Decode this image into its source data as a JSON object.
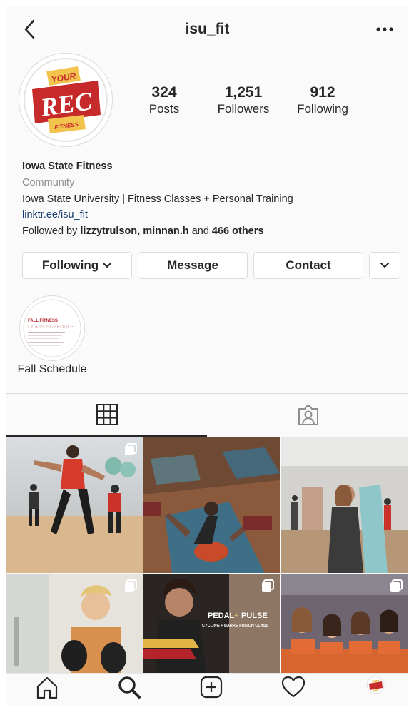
{
  "header": {
    "username": "isu_fit",
    "back_icon": "chevron-left-icon",
    "more_icon": "more-horizontal-icon"
  },
  "avatar": {
    "logo_top": "YOUR",
    "logo_main": "REC",
    "logo_bottom": "FITNESS",
    "colors": {
      "red": "#c62a2a",
      "gold": "#f2c44e"
    }
  },
  "stats": [
    {
      "value": "324",
      "label": "Posts"
    },
    {
      "value": "1,251",
      "label": "Followers"
    },
    {
      "value": "912",
      "label": "Following"
    }
  ],
  "bio": {
    "name": "Iowa State Fitness",
    "category": "Community",
    "description": "Iowa State University | Fitness Classes + Personal Training",
    "link": "linktr.ee/isu_fit",
    "followed_prefix": "Followed by ",
    "followed_users": "lizzytrulson, minnan.h",
    "followed_and": " and ",
    "followed_others": "466 others"
  },
  "buttons": {
    "following": "Following",
    "message": "Message",
    "contact": "Contact"
  },
  "highlight": {
    "label": "Fall Schedule",
    "cover_title_1": "FALL FITNESS",
    "cover_title_2": "CLASS SCHEDULE"
  },
  "tabs": [
    {
      "icon": "grid-icon",
      "active": true
    },
    {
      "icon": "tagged-icon",
      "active": false
    }
  ],
  "posts": [
    {
      "kind": "zumba class photo",
      "multi": true
    },
    {
      "kind": "yoga mats photo",
      "multi": false
    },
    {
      "kind": "woman with towel photo",
      "multi": false
    },
    {
      "kind": "boxing woman photo",
      "multi": true
    },
    {
      "kind": "pedal + pulse promo",
      "multi": true,
      "title_left": "PEDAL",
      "title_right": "PULSE",
      "subtitle": "CYCLING + BARRE FUSION CLASS"
    },
    {
      "kind": "staff group photo",
      "multi": true
    }
  ],
  "bottom_nav": [
    "home-icon",
    "search-icon",
    "new-post-icon",
    "activity-heart-icon",
    "profile-avatar-icon"
  ]
}
